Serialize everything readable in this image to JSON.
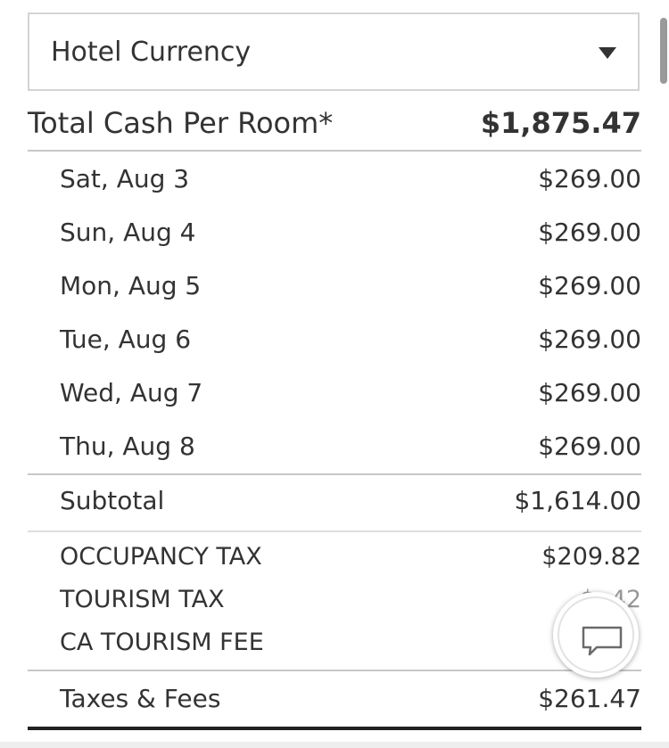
{
  "currency_select": {
    "selected": "Hotel Currency"
  },
  "total": {
    "label": "Total Cash Per Room*",
    "value": "$1,875.47"
  },
  "nights": [
    {
      "date": "Sat, Aug 3",
      "amount": "$269.00"
    },
    {
      "date": "Sun, Aug 4",
      "amount": "$269.00"
    },
    {
      "date": "Mon, Aug 5",
      "amount": "$269.00"
    },
    {
      "date": "Tue, Aug 6",
      "amount": "$269.00"
    },
    {
      "date": "Wed, Aug 7",
      "amount": "$269.00"
    },
    {
      "date": "Thu, Aug 8",
      "amount": "$269.00"
    }
  ],
  "subtotal": {
    "label": "Subtotal",
    "value": "$1,614.00"
  },
  "taxes": [
    {
      "label": "OCCUPANCY TAX",
      "amount": "$209.82"
    },
    {
      "label": "TOURISM TAX",
      "amount": "$..42"
    },
    {
      "label": "CA TOURISM FEE",
      "amount": ""
    }
  ],
  "taxes_total": {
    "label": "Taxes & Fees",
    "value": "$261.47"
  },
  "icons": {
    "caret": "chevron-down-icon",
    "chat": "chat-bubble-icon"
  },
  "colors": {
    "text": "#333333",
    "border": "#c7c7c7",
    "bottom_rule": "#222222"
  }
}
